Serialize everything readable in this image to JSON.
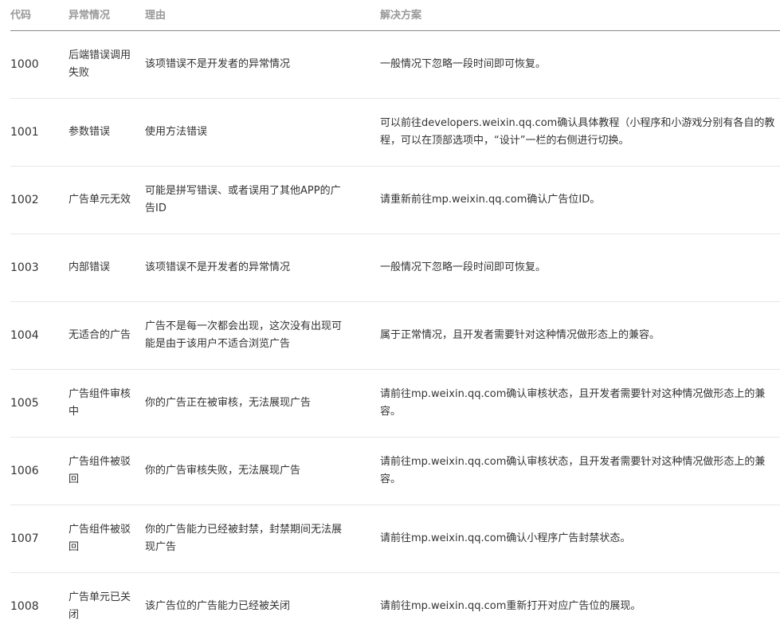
{
  "header": {
    "code": "代码",
    "exception": "异常情况",
    "reason": "理由",
    "solution": "解决方案"
  },
  "rows": [
    {
      "code": "1000",
      "exception": "后端错误调用失败",
      "reason": "该项错误不是开发者的异常情况",
      "solution": "一般情况下忽略一段时间即可恢复。"
    },
    {
      "code": "1001",
      "exception": "参数错误",
      "reason": "使用方法错误",
      "solution": "可以前往developers.weixin.qq.com确认具体教程（小程序和小游戏分别有各自的教程，可以在顶部选项中，“设计”一栏的右侧进行切换。"
    },
    {
      "code": "1002",
      "exception": "广告单元无效",
      "reason": "可能是拼写错误、或者误用了其他APP的广告ID",
      "solution": "请重新前往mp.weixin.qq.com确认广告位ID。"
    },
    {
      "code": "1003",
      "exception": "内部错误",
      "reason": "该项错误不是开发者的异常情况",
      "solution": "一般情况下忽略一段时间即可恢复。"
    },
    {
      "code": "1004",
      "exception": "无适合的广告",
      "reason": "广告不是每一次都会出现，这次没有出现可能是由于该用户不适合浏览广告",
      "solution": "属于正常情况，且开发者需要针对这种情况做形态上的兼容。"
    },
    {
      "code": "1005",
      "exception": "广告组件审核中",
      "reason": "你的广告正在被审核，无法展现广告",
      "solution": "请前往mp.weixin.qq.com确认审核状态，且开发者需要针对这种情况做形态上的兼容。"
    },
    {
      "code": "1006",
      "exception": "广告组件被驳回",
      "reason": "你的广告审核失败，无法展现广告",
      "solution": "请前往mp.weixin.qq.com确认审核状态，且开发者需要针对这种情况做形态上的兼容。"
    },
    {
      "code": "1007",
      "exception": "广告组件被驳回",
      "reason": "你的广告能力已经被封禁，封禁期间无法展现广告",
      "solution": "请前往mp.weixin.qq.com确认小程序广告封禁状态。"
    },
    {
      "code": "1008",
      "exception": "广告单元已关闭",
      "reason": "该广告位的广告能力已经被关闭",
      "solution": "请前往mp.weixin.qq.com重新打开对应广告位的展现。"
    }
  ]
}
